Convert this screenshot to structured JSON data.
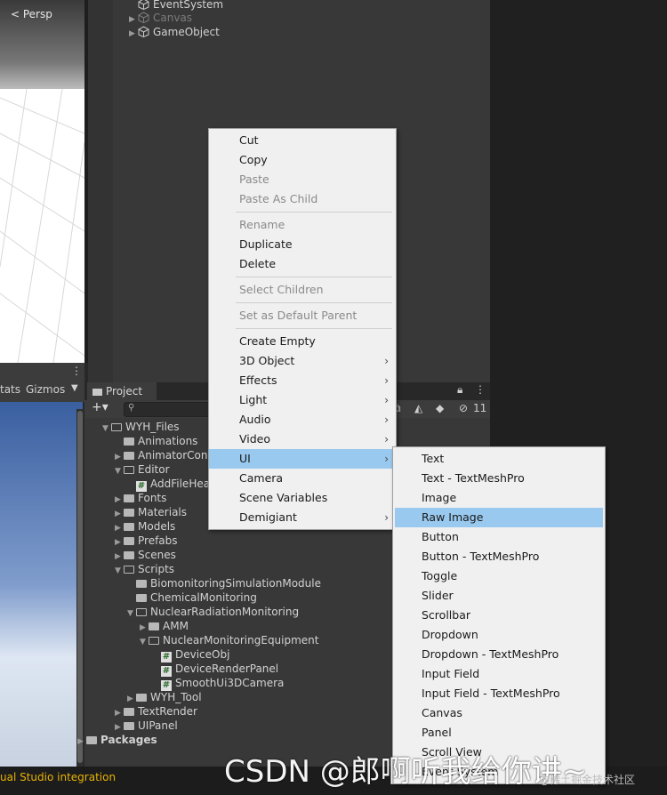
{
  "scene": {
    "persp_label": "< Persp"
  },
  "hierarchy": {
    "items": [
      {
        "label": "EventSystem",
        "dim": false
      },
      {
        "label": "Canvas",
        "dim": true
      },
      {
        "label": "GameObject",
        "dim": false
      }
    ]
  },
  "game_toolbar": {
    "stats_label": "tats",
    "gizmos_label": "Gizmos"
  },
  "project": {
    "tab_label": "Project",
    "plus_label": "+▾",
    "visibility_count": "11",
    "tree": [
      {
        "label": "WYH_Files",
        "type": "folder-open",
        "indent": 0,
        "arrow": "▼"
      },
      {
        "label": "Animations",
        "type": "folder",
        "indent": 1,
        "arrow": ""
      },
      {
        "label": "AnimatorCont",
        "type": "folder",
        "indent": 1,
        "arrow": "▶"
      },
      {
        "label": "Editor",
        "type": "folder-open",
        "indent": 1,
        "arrow": "▼"
      },
      {
        "label": "AddFileHea",
        "type": "script",
        "indent": 2,
        "arrow": ""
      },
      {
        "label": "Fonts",
        "type": "folder",
        "indent": 1,
        "arrow": "▶"
      },
      {
        "label": "Materials",
        "type": "folder",
        "indent": 1,
        "arrow": "▶"
      },
      {
        "label": "Models",
        "type": "folder",
        "indent": 1,
        "arrow": "▶"
      },
      {
        "label": "Prefabs",
        "type": "folder",
        "indent": 1,
        "arrow": "▶"
      },
      {
        "label": "Scenes",
        "type": "folder",
        "indent": 1,
        "arrow": "▶"
      },
      {
        "label": "Scripts",
        "type": "folder-open",
        "indent": 1,
        "arrow": "▼"
      },
      {
        "label": "BiomonitoringSimulationModule",
        "type": "folder",
        "indent": 2,
        "arrow": ""
      },
      {
        "label": "ChemicalMonitoring",
        "type": "folder",
        "indent": 2,
        "arrow": ""
      },
      {
        "label": "NuclearRadiationMonitoring",
        "type": "folder-open",
        "indent": 2,
        "arrow": "▼"
      },
      {
        "label": "AMM",
        "type": "folder",
        "indent": 3,
        "arrow": "▶"
      },
      {
        "label": "NuclearMonitoringEquipment",
        "type": "folder-open",
        "indent": 3,
        "arrow": "▼"
      },
      {
        "label": "DeviceObj",
        "type": "script",
        "indent": 4,
        "arrow": ""
      },
      {
        "label": "DeviceRenderPanel",
        "type": "script",
        "indent": 4,
        "arrow": ""
      },
      {
        "label": "SmoothUi3DCamera",
        "type": "script",
        "indent": 4,
        "arrow": ""
      },
      {
        "label": "WYH_Tool",
        "type": "folder",
        "indent": 2,
        "arrow": "▶"
      },
      {
        "label": "TextRender",
        "type": "folder",
        "indent": 1,
        "arrow": "▶"
      },
      {
        "label": "UIPanel",
        "type": "folder",
        "indent": 1,
        "arrow": "▶"
      },
      {
        "label": "Packages",
        "type": "folder",
        "indent": -1,
        "arrow": "▶",
        "bold": true
      }
    ]
  },
  "context_menu": {
    "items": [
      {
        "label": "Cut",
        "disabled": false
      },
      {
        "label": "Copy",
        "disabled": false
      },
      {
        "label": "Paste",
        "disabled": true
      },
      {
        "label": "Paste As Child",
        "disabled": true
      },
      {
        "label": "Rename",
        "disabled": true
      },
      {
        "label": "Duplicate",
        "disabled": false
      },
      {
        "label": "Delete",
        "disabled": false
      },
      {
        "label": "Select Children",
        "disabled": true
      },
      {
        "label": "Set as Default Parent",
        "disabled": true
      },
      {
        "label": "Create Empty",
        "disabled": false
      },
      {
        "label": "3D Object",
        "disabled": false,
        "submenu": true
      },
      {
        "label": "Effects",
        "disabled": false,
        "submenu": true
      },
      {
        "label": "Light",
        "disabled": false,
        "submenu": true
      },
      {
        "label": "Audio",
        "disabled": false,
        "submenu": true
      },
      {
        "label": "Video",
        "disabled": false,
        "submenu": true
      },
      {
        "label": "UI",
        "disabled": false,
        "submenu": true,
        "selected": true
      },
      {
        "label": "Camera",
        "disabled": false
      },
      {
        "label": "Scene Variables",
        "disabled": false
      },
      {
        "label": "Demigiant",
        "disabled": false,
        "submenu": true
      }
    ]
  },
  "ui_submenu": {
    "items": [
      {
        "label": "Text"
      },
      {
        "label": "Text - TextMeshPro"
      },
      {
        "label": "Image"
      },
      {
        "label": "Raw Image",
        "selected": true
      },
      {
        "label": "Button"
      },
      {
        "label": "Button - TextMeshPro"
      },
      {
        "label": "Toggle"
      },
      {
        "label": "Slider"
      },
      {
        "label": "Scrollbar"
      },
      {
        "label": "Dropdown"
      },
      {
        "label": "Dropdown - TextMeshPro"
      },
      {
        "label": "Input Field"
      },
      {
        "label": "Input Field - TextMeshPro"
      },
      {
        "label": "Canvas"
      },
      {
        "label": "Panel"
      },
      {
        "label": "Scroll View"
      },
      {
        "label": "Event System"
      }
    ]
  },
  "status": {
    "text": "ual Studio integration"
  },
  "watermark": {
    "text": "CSDN @郎啊听我给你讲~",
    "sub": "@稀土掘金技术社区"
  }
}
